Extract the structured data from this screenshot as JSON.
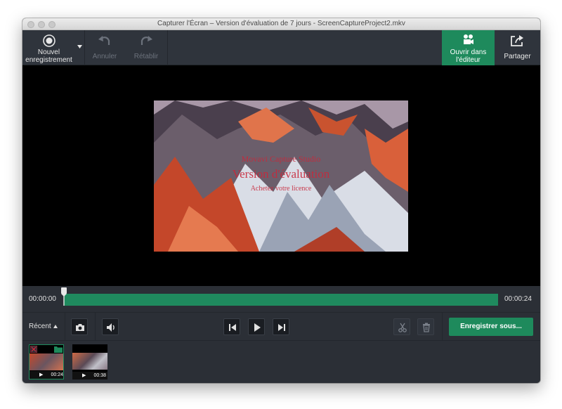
{
  "window": {
    "title": "Capturer l'Écran – Version d'évaluation de 7 jours - ScreenCaptureProject2.mkv"
  },
  "toolbar": {
    "new_recording_line1": "Nouvel",
    "new_recording_line2": "enregistrement",
    "undo": "Annuler",
    "redo": "Rétablir",
    "open_editor_line1": "Ouvrir dans",
    "open_editor_line2": "l'éditeur",
    "share": "Partager"
  },
  "preview": {
    "watermark_line1": "Movavi Capture Studio",
    "watermark_line2": "Version d'évaluation",
    "watermark_line3": "Achetez votre licence"
  },
  "timeline": {
    "start": "00:00:00",
    "end": "00:00:24"
  },
  "controls": {
    "recent": "Récent",
    "save_as": "Enregistrer sous..."
  },
  "thumbnails": [
    {
      "duration": "00:24"
    },
    {
      "duration": "00:38"
    }
  ],
  "colors": {
    "accent": "#1e8a5c",
    "background": "#2b2f36"
  }
}
